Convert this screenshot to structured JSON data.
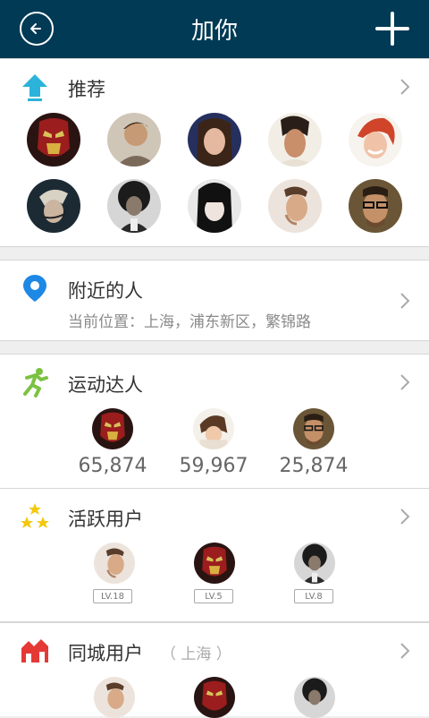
{
  "header": {
    "title": "加你"
  },
  "recommend": {
    "title": "推荐",
    "avatars": [
      "iron-man",
      "man-smiling",
      "woman-blue",
      "man-portrait",
      "woman-redhead",
      "woman-mic",
      "curly-hair",
      "woman-bangs",
      "man-stubble",
      "man-glasses"
    ]
  },
  "nearby": {
    "title": "附近的人",
    "location": "当前位置：上海，浦东新区，繁锦路"
  },
  "sports": {
    "title": "运动达人",
    "users": [
      {
        "avatar": "iron-man",
        "count": "65,874"
      },
      {
        "avatar": "girl-lying",
        "count": "59,967"
      },
      {
        "avatar": "man-glasses",
        "count": "25,874"
      }
    ]
  },
  "active": {
    "title": "活跃用户",
    "users": [
      {
        "avatar": "man-stubble",
        "level": "LV.18"
      },
      {
        "avatar": "iron-man",
        "level": "LV.5"
      },
      {
        "avatar": "curly-hair",
        "level": "LV.8"
      }
    ]
  },
  "city": {
    "title": "同城用户",
    "note": "（ 上海 ）",
    "avatars": [
      "man-stubble",
      "iron-man",
      "curly-hair"
    ]
  },
  "colors": {
    "header": "#003a55",
    "recommend_icon": "#2bb3d9",
    "nearby_icon": "#1e88e5",
    "sports_icon": "#7cc242",
    "active_icon": "#f4c80f",
    "city_icon": "#e53935"
  }
}
